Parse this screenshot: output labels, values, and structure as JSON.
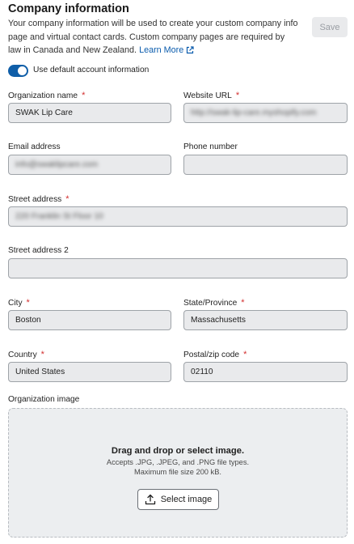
{
  "header": {
    "title": "Company information",
    "description": "Your company information will be used to create your custom company info page and virtual contact cards. Custom company pages are required by law in Canada and New Zealand.",
    "learn_more": "Learn More",
    "save_label": "Save"
  },
  "toggle": {
    "label": "Use default account information",
    "checked": true,
    "color": "#0f5ea8"
  },
  "fields": {
    "org_name": {
      "label": "Organization name",
      "required": "*",
      "value": "SWAK Lip Care"
    },
    "website": {
      "label": "Website URL",
      "required": "*",
      "value": "http://swak-lip-care.myshopify.com"
    },
    "email": {
      "label": "Email address",
      "value": "info@swaklipcare.com"
    },
    "phone": {
      "label": "Phone number",
      "value": ""
    },
    "street": {
      "label": "Street address",
      "required": "*",
      "value": "220 Franklin St Floor 10"
    },
    "street2": {
      "label": "Street address 2",
      "value": ""
    },
    "city": {
      "label": "City",
      "required": "*",
      "value": "Boston"
    },
    "state": {
      "label": "State/Province",
      "required": "*",
      "value": "Massachusetts"
    },
    "country": {
      "label": "Country",
      "required": "*",
      "value": "United States"
    },
    "zip": {
      "label": "Postal/zip code",
      "required": "*",
      "value": "02110"
    }
  },
  "image": {
    "label": "Organization image",
    "drop_title": "Drag and drop or select image.",
    "accepts": "Accepts .JPG, .JPEG, and .PNG file types.",
    "max_size": "Maximum file size 200 kB.",
    "select_label": "Select image"
  },
  "icons": {
    "external": "external-link-icon",
    "upload": "upload-icon"
  },
  "colors": {
    "link": "#0b5cad",
    "required": "#d32f2f"
  }
}
